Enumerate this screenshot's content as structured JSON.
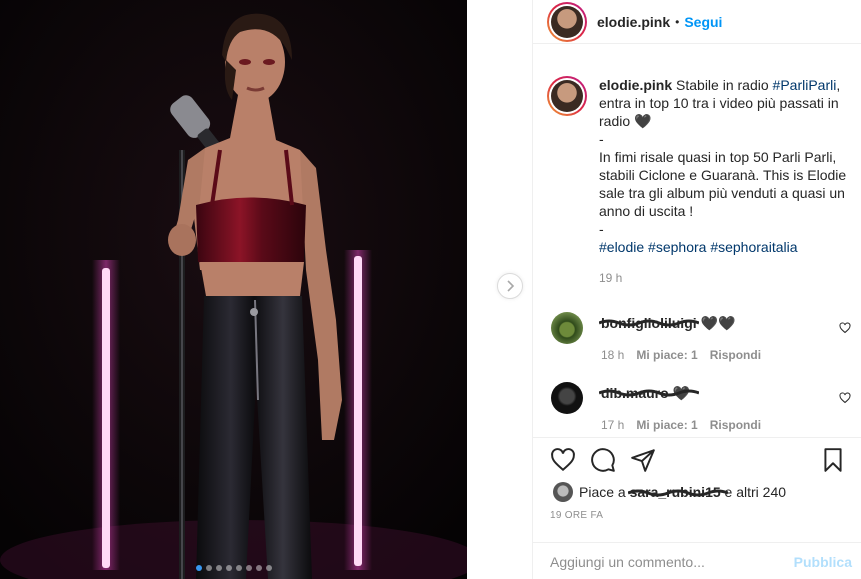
{
  "post": {
    "carousel": {
      "slides": 8,
      "active_index": 0
    },
    "next_icon": "chevron-right-icon"
  },
  "header": {
    "username": "elodie.pink",
    "bullet": "•",
    "follow_label": "Segui"
  },
  "caption": {
    "username": "elodie.pink",
    "text1": "Stabile in radio",
    "tag_parli": "#ParliParli",
    "text2": ", entra in top 10 tra i video più passati in radio",
    "emoji": "🖤",
    "dash1": "-",
    "text3": "In fimi risale quasi in top 50 Parli Parli, stabili Ciclone e Guaranà. This is Elodie sale tra gli album più venduti a quasi un anno di uscita !",
    "dash2": "-",
    "tags": [
      "#elodie",
      "#sephora",
      "#sephoraitalia"
    ],
    "time": "19 h"
  },
  "comments": [
    {
      "username": "bonfiglioliluigi",
      "text": "🖤🖤",
      "time": "18 h",
      "likes": "Mi piace: 1",
      "reply": "Rispondi"
    },
    {
      "username": "dib.mauro",
      "text": "🖤",
      "time": "17 h",
      "likes": "Mi piace: 1",
      "reply": "Rispondi"
    }
  ],
  "actions": {
    "icons": [
      "heart-icon",
      "comment-icon",
      "share-icon",
      "bookmark-icon"
    ]
  },
  "likes": {
    "prefix": "Piace a",
    "user": "sara_rubini15",
    "suffix": "e altri 240"
  },
  "date": "19 ORE FA",
  "add_comment": {
    "placeholder": "Aggiungi un commento...",
    "publish_label": "Pubblica"
  },
  "colors": {
    "accent": "#0095f6",
    "hashtag": "#00376b",
    "muted": "#8e8e8e",
    "publish_disabled": "#b2dffc",
    "neon_pink": "#ff4fd8"
  }
}
